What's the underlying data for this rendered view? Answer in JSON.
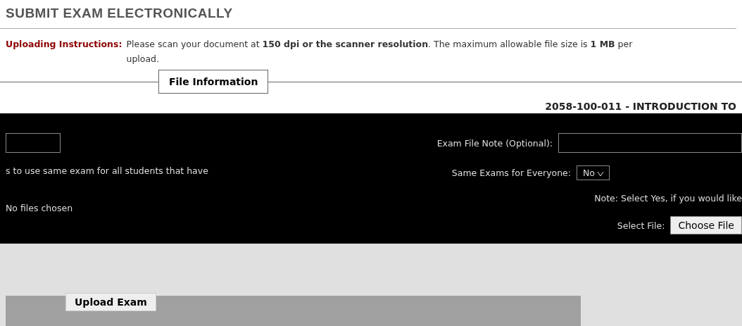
{
  "title": "SUBMIT EXAM ELECTRONICALLY",
  "instructions": {
    "label": "Uploading Instructions:",
    "lines": [
      "Please scan your document at **150 dpi or the scanner resolution**. The maximum allowable file size is **1 MB** per",
      "upload."
    ]
  },
  "fieldset": {
    "legend": "File Information",
    "course": "2058-100-011 - INTRODUCTION TO"
  },
  "left": {
    "note": "s to use same exam for all students that have",
    "file_status": "No files chosen"
  },
  "right": {
    "note_label": "Exam File Note (Optional):",
    "same_label": "Same Exams for Everyone:",
    "same_value": "No",
    "hint": "Note: Select Yes, if you would like",
    "select_label": "Select File:",
    "choose_button": "Choose File"
  },
  "upload_button": "Upload Exam"
}
